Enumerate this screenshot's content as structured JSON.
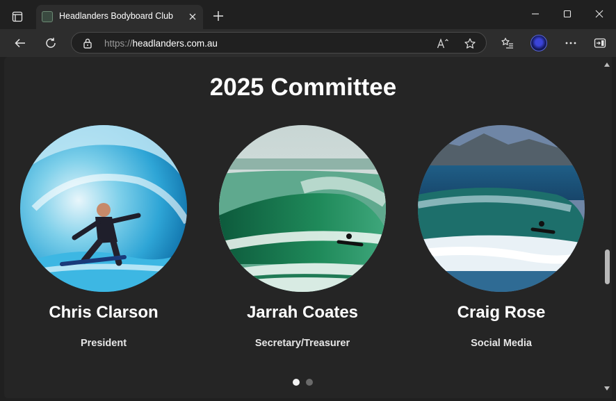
{
  "browser": {
    "tab": {
      "title": "Headlanders Bodyboard Club"
    },
    "address": {
      "scheme": "https://",
      "host": "headlanders.com.au"
    }
  },
  "page": {
    "heading": "2025 Committee",
    "members": [
      {
        "name": "Chris Clarson",
        "role": "President",
        "photo_icon": "surfer-barrel-photo"
      },
      {
        "name": "Jarrah Coates",
        "role": "Secretary/Treasurer",
        "photo_icon": "green-wave-photo"
      },
      {
        "name": "Craig Rose",
        "role": "Social Media",
        "photo_icon": "coastal-wave-photo"
      }
    ],
    "carousel": {
      "active_index": 0,
      "count": 2
    }
  },
  "colors": {
    "background": "#252525",
    "chrome": "#202020",
    "toolbar": "#2d2d2d",
    "text": "#ffffff"
  }
}
